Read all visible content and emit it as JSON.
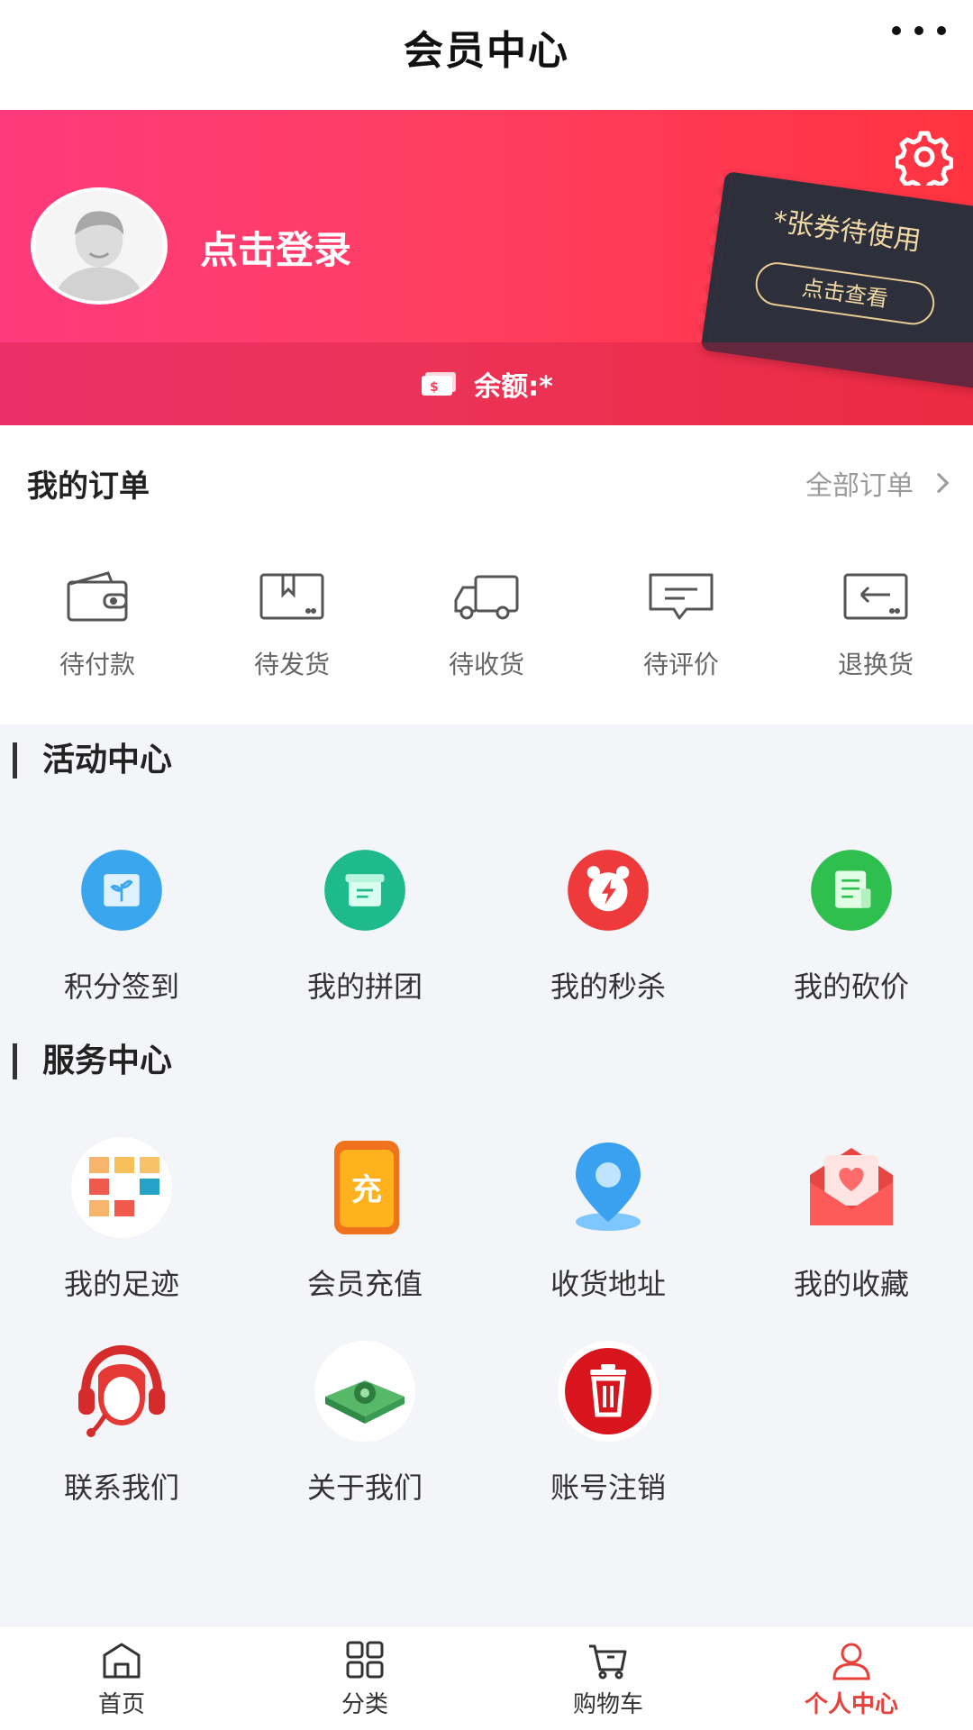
{
  "header": {
    "title": "会员中心",
    "more_icon": "more-dots-icon"
  },
  "profile": {
    "login_text": "点击登录",
    "coupon_text": "*张券待使用",
    "coupon_button": "点击查看",
    "balance_label": "余额:*"
  },
  "orders": {
    "title": "我的订单",
    "all_orders": "全部订单",
    "items": [
      {
        "label": "待付款",
        "icon": "wallet-icon"
      },
      {
        "label": "待发货",
        "icon": "package-icon"
      },
      {
        "label": "待收货",
        "icon": "truck-icon"
      },
      {
        "label": "待评价",
        "icon": "comment-icon"
      },
      {
        "label": "退换货",
        "icon": "return-icon"
      }
    ]
  },
  "activity": {
    "title": "活动中心",
    "items": [
      {
        "label": "积分签到",
        "icon": "checkin-book-icon",
        "color": "#3aa6ee"
      },
      {
        "label": "我的拼团",
        "icon": "group-box-icon",
        "color": "#1fba8c"
      },
      {
        "label": "我的秒杀",
        "icon": "alarm-clock-icon",
        "color": "#ee3a3a"
      },
      {
        "label": "我的砍价",
        "icon": "note-icon",
        "color": "#2fbf4f"
      }
    ]
  },
  "service": {
    "title": "服务中心",
    "items": [
      {
        "label": "我的足迹",
        "icon": "footprint-grid-icon"
      },
      {
        "label": "会员充值",
        "icon": "recharge-icon",
        "badge": "充"
      },
      {
        "label": "收货地址",
        "icon": "location-pin-icon"
      },
      {
        "label": "我的收藏",
        "icon": "heart-envelope-icon"
      },
      {
        "label": "联系我们",
        "icon": "headset-icon"
      },
      {
        "label": "关于我们",
        "icon": "book-gear-icon"
      },
      {
        "label": "账号注销",
        "icon": "trash-icon"
      }
    ]
  },
  "tabbar": {
    "items": [
      {
        "label": "首页",
        "icon": "home-icon"
      },
      {
        "label": "分类",
        "icon": "category-icon"
      },
      {
        "label": "购物车",
        "icon": "cart-icon"
      },
      {
        "label": "个人中心",
        "icon": "user-icon",
        "active": true
      }
    ],
    "active_color": "#e8413b"
  }
}
